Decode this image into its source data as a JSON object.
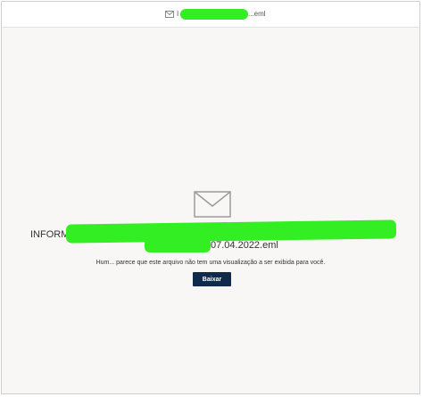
{
  "titlebar": {
    "icon": "mail-icon",
    "title_prefix": "I",
    "title_suffix": "...eml"
  },
  "preview": {
    "icon": "envelope-icon",
    "filename_start": "INFORM",
    "filename_end": "07.04.2022.eml",
    "message": "Hum... parece que este arquivo não tem uma visualização a ser exibida para você.",
    "download_label": "Baixar"
  },
  "colors": {
    "redaction": "#33ee22",
    "button_bg": "#0f2a4a",
    "preview_bg": "#f8f7f6"
  }
}
